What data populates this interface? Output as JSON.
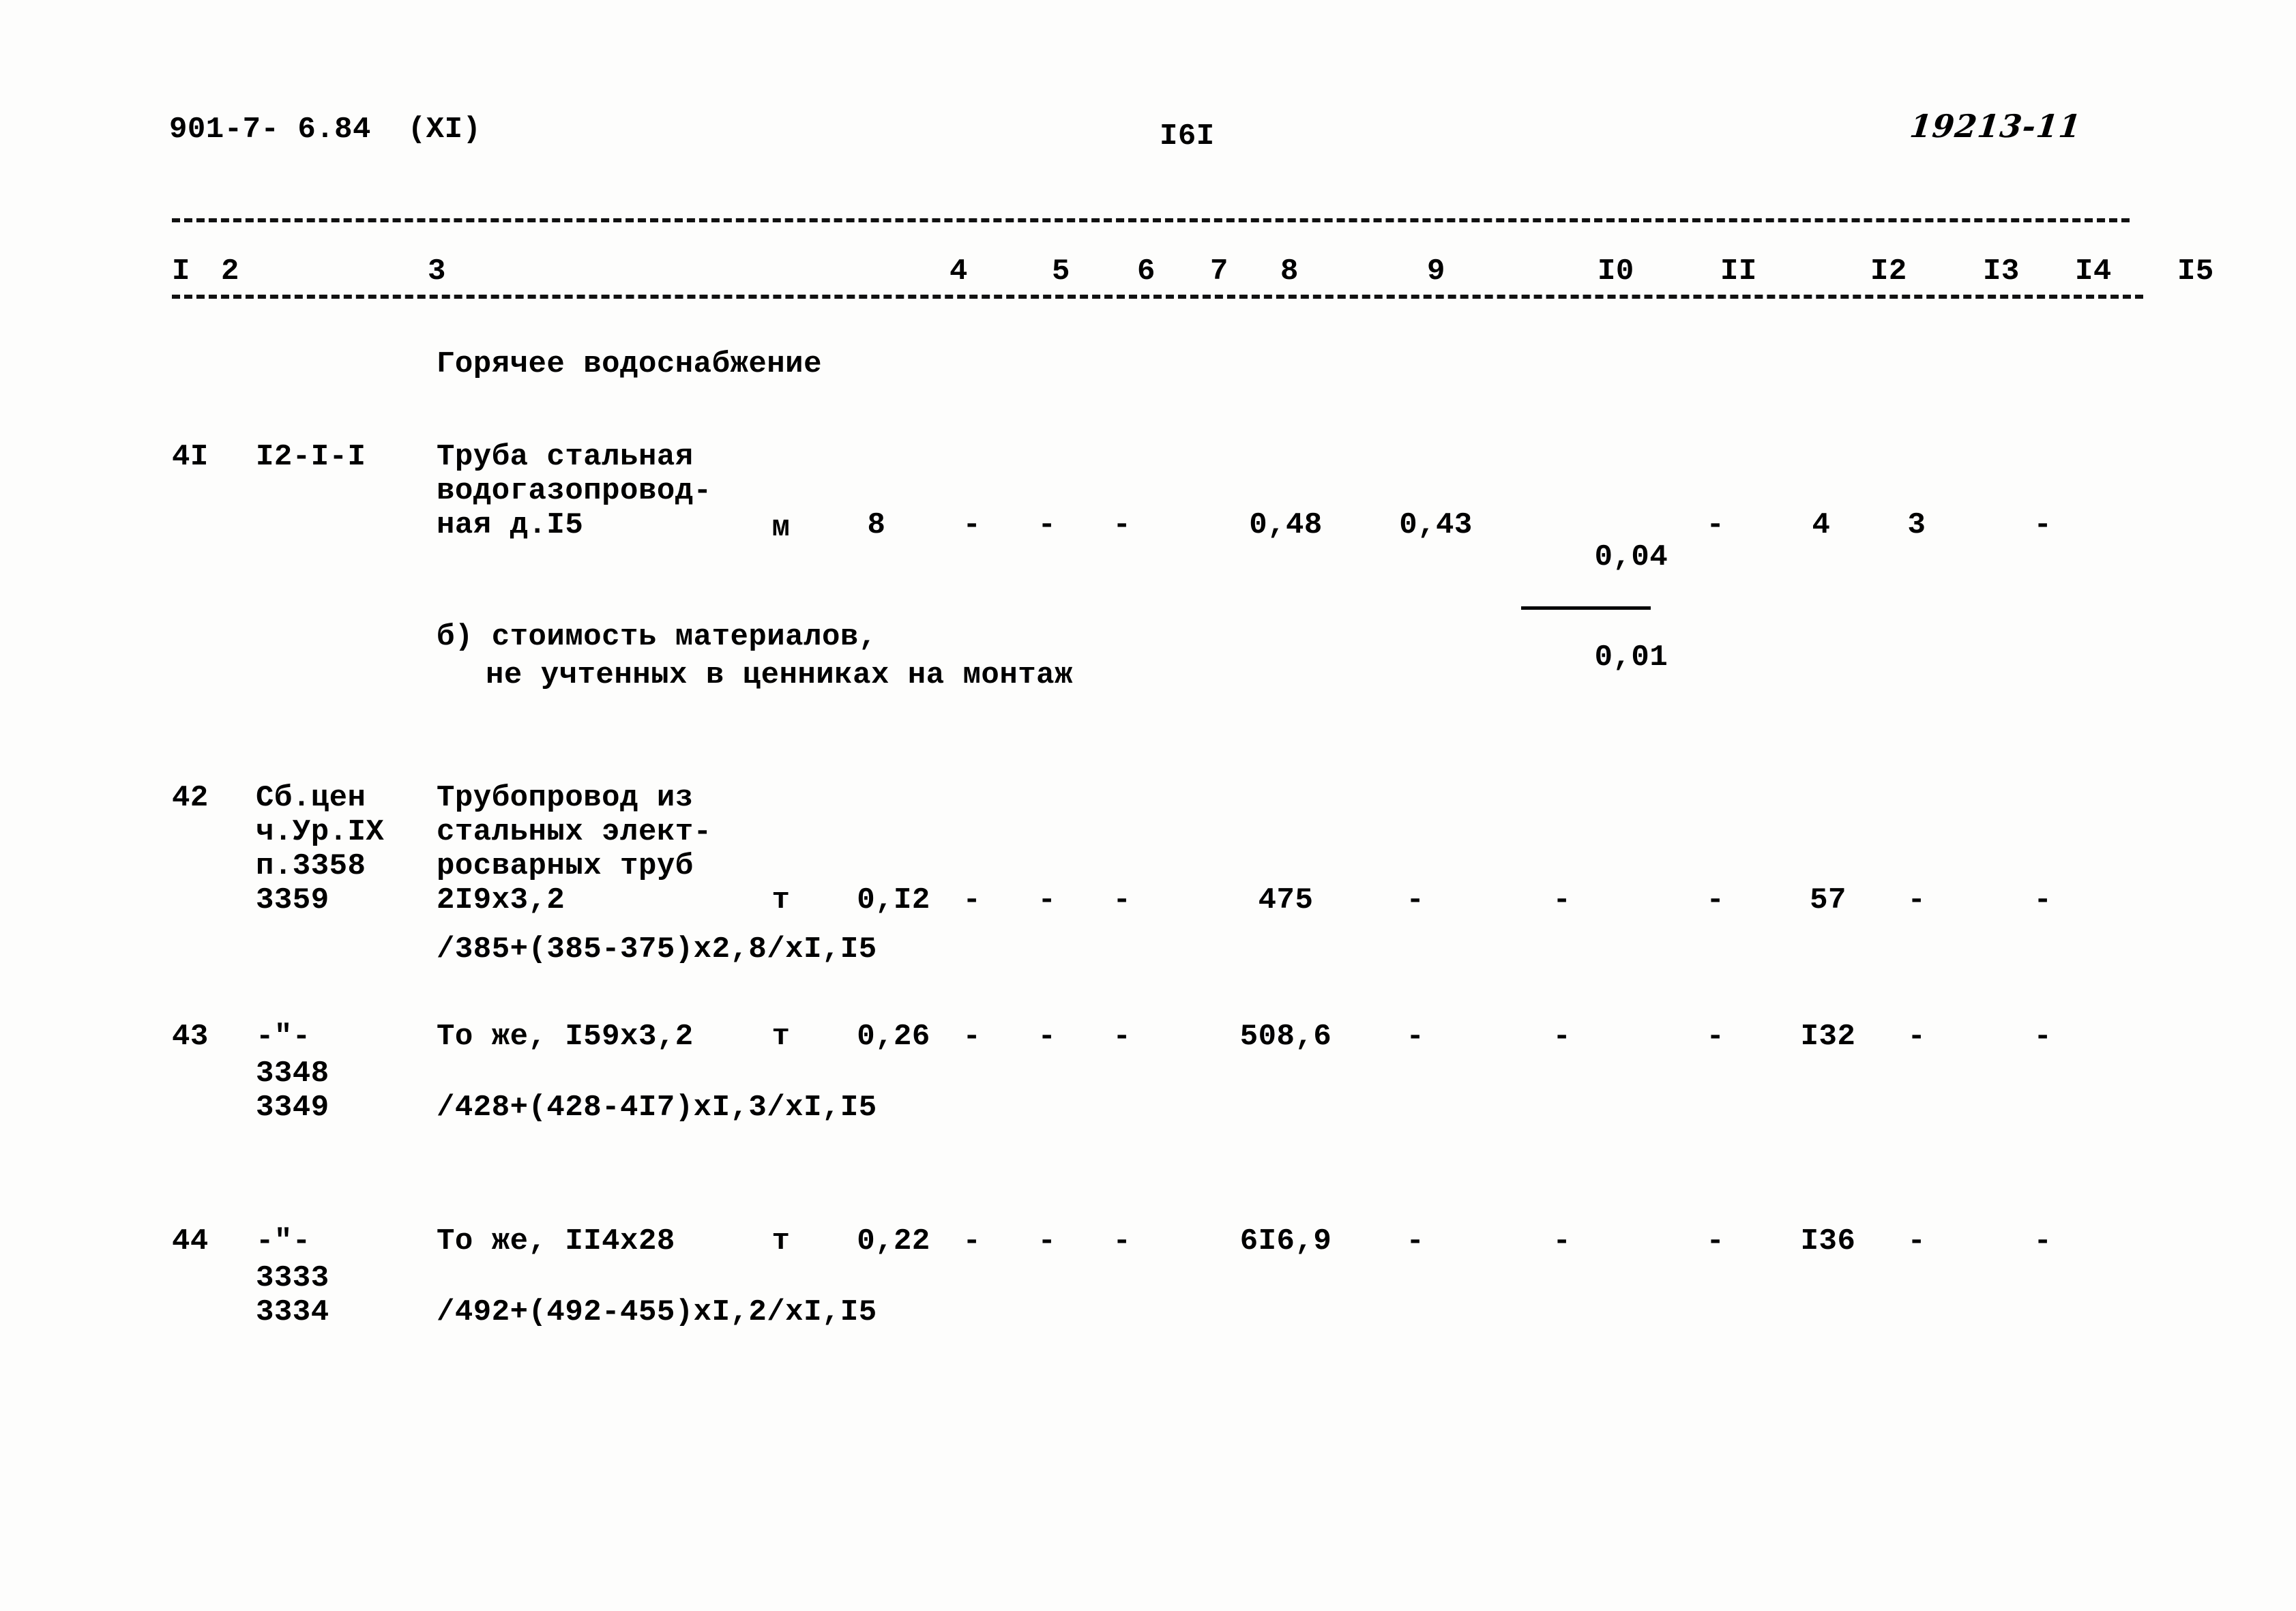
{
  "header": {
    "doc_code": "901-7- 6.84  (XI)",
    "page_number": "I6I",
    "hand_note": "19213-11"
  },
  "table": {
    "column_numbers": [
      "I",
      "2",
      "3",
      "4",
      "5",
      "6",
      "7",
      "8",
      "9",
      "I0",
      "II",
      "I2",
      "I3",
      "I4",
      "I5"
    ],
    "section_title": "Горячее водоснабжение",
    "subsection_title_line1": "б) стоимость материалов,",
    "subsection_title_line2": "не учтенных в ценниках на монтаж",
    "rows": [
      {
        "no": "4I",
        "code": "I2-I-I",
        "name_line1": "Труба стальная",
        "name_line2": "водогазопровод-",
        "name_line3": "ная д.I5",
        "unit": "м",
        "c4": "8",
        "c5": "-",
        "c6": "-",
        "c7": "-",
        "c8": "",
        "c9": "0,48",
        "c10": "0,43",
        "c11_top": "0,04",
        "c11_bottom": "0,01",
        "c12": "-",
        "c13": "4",
        "c14": "3",
        "c15": "-"
      },
      {
        "no": "42",
        "code_line1": "Сб.цен",
        "code_line2": "ч.Ур.IX",
        "code_line3": "п.3358",
        "code_line4": "3359",
        "name_line1": "Трубопровод из",
        "name_line2": "стальных элект-",
        "name_line3": "росварных труб",
        "name_line4": "2I9х3,2",
        "formula": "/385+(385-375)х2,8/хI,I5",
        "unit": "т",
        "c4": "0,I2",
        "c5": "-",
        "c6": "-",
        "c7": "-",
        "c9": "475",
        "c10": "-",
        "c11": "-",
        "c12": "-",
        "c13": "57",
        "c14": "-",
        "c15": "-"
      },
      {
        "no": "43",
        "code_line1": "-\"-",
        "code_line2": "3348",
        "code_line3": "3349",
        "name_line1": "То же, I59х3,2",
        "formula": "/428+(428-4I7)хI,3/хI,I5",
        "unit": "т",
        "c4": "0,26",
        "c5": "-",
        "c6": "-",
        "c7": "-",
        "c9": "508,6",
        "c10": "-",
        "c11": "-",
        "c12": "-",
        "c13": "I32",
        "c14": "-",
        "c15": "-"
      },
      {
        "no": "44",
        "code_line1": "-\"-",
        "code_line2": "3333",
        "code_line3": "3334",
        "name_line1": "То же, II4х28",
        "formula": "/492+(492-455)хI,2/хI,I5",
        "unit": "т",
        "c4": "0,22",
        "c5": "-",
        "c6": "-",
        "c7": "-",
        "c9": "6I6,9",
        "c10": "-",
        "c11": "-",
        "c12": "-",
        "c13": "I36",
        "c14": "-",
        "c15": "-"
      }
    ]
  }
}
